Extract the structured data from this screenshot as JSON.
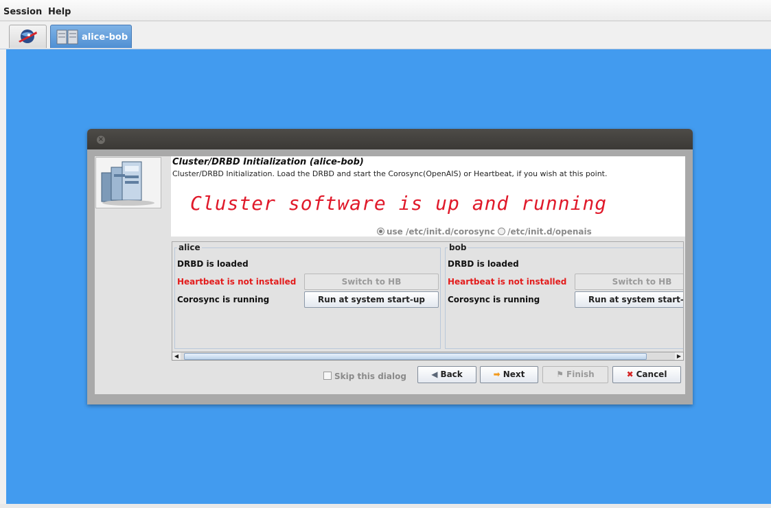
{
  "menu": {
    "session": "Session",
    "help": "Help"
  },
  "tabs": {
    "cluster_tab_label": "alice-bob"
  },
  "dialog": {
    "title": "Cluster/DRBD Initialization (alice-bob)",
    "description": "Cluster/DRBD Initialization. Load the DRBD and start the Corosync(OpenAIS) or Heartbeat, if you wish at this point.",
    "status_message": "Cluster software is up and running",
    "radio_options": [
      {
        "label": "use /etc/init.d/corosync",
        "checked": true
      },
      {
        "label": "/etc/init.d/openais",
        "checked": false
      }
    ],
    "hosts": [
      {
        "name": "alice",
        "drbd_status": "DRBD is loaded",
        "heartbeat_status": "Heartbeat is not installed",
        "heartbeat_button": "Switch to HB",
        "corosync_status": "Corosync is running",
        "corosync_button": "Run at system start-up"
      },
      {
        "name": "bob",
        "drbd_status": "DRBD is loaded",
        "heartbeat_status": "Heartbeat is not installed",
        "heartbeat_button": "Switch to HB",
        "corosync_status": "Corosync is running",
        "corosync_button": "Run at system start-up"
      }
    ],
    "skip_label": "Skip this dialog",
    "buttons": {
      "back": "Back",
      "next": "Next",
      "finish": "Finish",
      "cancel": "Cancel"
    }
  },
  "colors": {
    "desktop_bg": "#429bef",
    "error_text": "#e31c1c",
    "status_message": "#e0192a",
    "tab_active": "#5a9ad9"
  }
}
